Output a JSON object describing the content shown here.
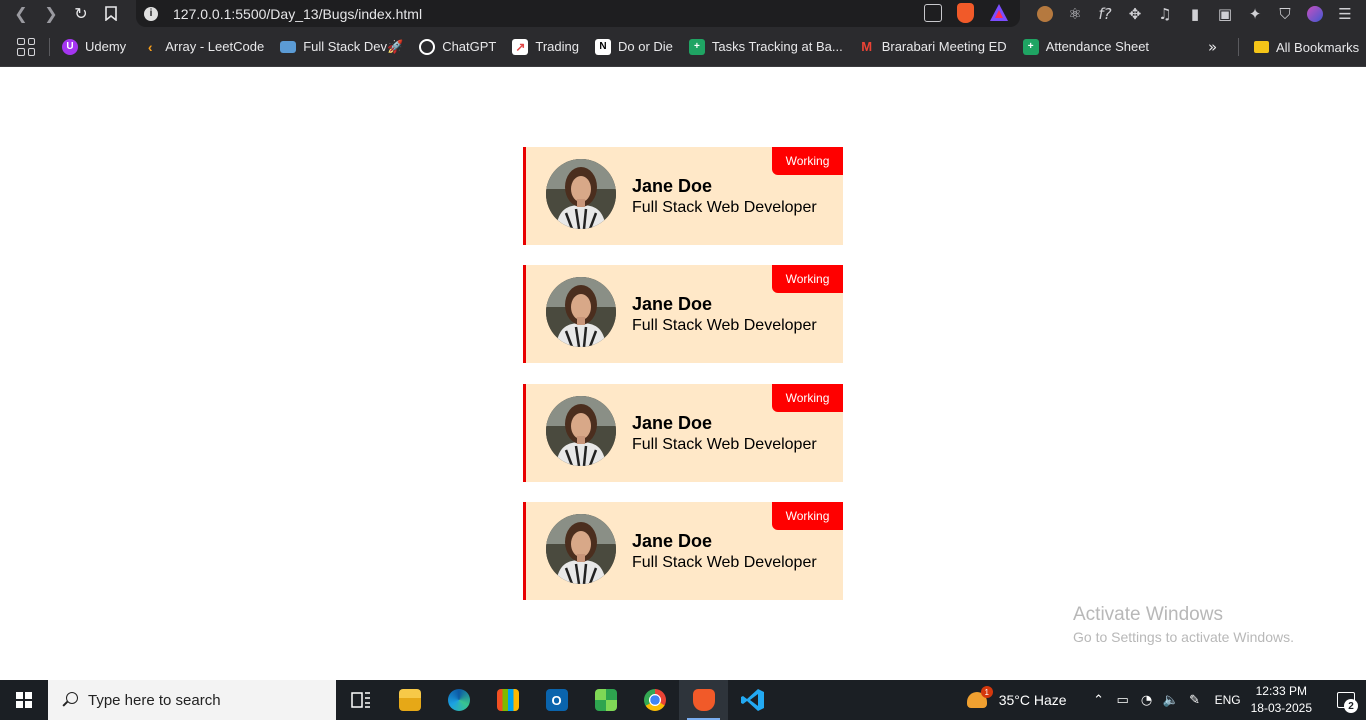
{
  "browser": {
    "url": "127.0.0.1:5500/Day_13/Bugs/index.html",
    "bookmarks": [
      {
        "label": "Udemy",
        "icon": "udemy-icon",
        "color": "#a435f0",
        "glyph": "U"
      },
      {
        "label": "Array - LeetCode",
        "icon": "leetcode-icon",
        "color": "#f89f1b",
        "glyph": "L"
      },
      {
        "label": "Full Stack Dev🚀",
        "icon": "monitor-icon",
        "color": "#5b9bd5",
        "glyph": ""
      },
      {
        "label": "ChatGPT",
        "icon": "chatgpt-icon",
        "color": "#ffffff",
        "glyph": ""
      },
      {
        "label": "Trading",
        "icon": "chart-icon",
        "color": "#e04848",
        "glyph": ""
      },
      {
        "label": "Do or Die",
        "icon": "notion-icon",
        "color": "#ffffff",
        "glyph": "N"
      },
      {
        "label": "Tasks Tracking at Ba...",
        "icon": "sheets-icon",
        "color": "#1fa463",
        "glyph": "+"
      },
      {
        "label": "Brarabari Meeting ED",
        "icon": "gmail-icon",
        "color": "#ea4335",
        "glyph": "M"
      },
      {
        "label": "Attendance Sheet",
        "icon": "sheets-icon",
        "color": "#1fa463",
        "glyph": "+"
      }
    ],
    "all_bookmarks": "All Bookmarks"
  },
  "cards": [
    {
      "status": "Working",
      "name": "Jane Doe",
      "role": "Full Stack Web Developer"
    },
    {
      "status": "Working",
      "name": "Jane Doe",
      "role": "Full Stack Web Developer"
    },
    {
      "status": "Working",
      "name": "Jane Doe",
      "role": "Full Stack Web Developer"
    },
    {
      "status": "Working",
      "name": "Jane Doe",
      "role": "Full Stack Web Developer"
    }
  ],
  "watermark": {
    "title": "Activate Windows",
    "subtitle": "Go to Settings to activate Windows."
  },
  "taskbar": {
    "search_placeholder": "Type here to search",
    "weather": "35°C  Haze",
    "weather_badge": "1",
    "language": "ENG",
    "time": "12:33 PM",
    "date": "18-03-2025",
    "notifications": "2"
  }
}
